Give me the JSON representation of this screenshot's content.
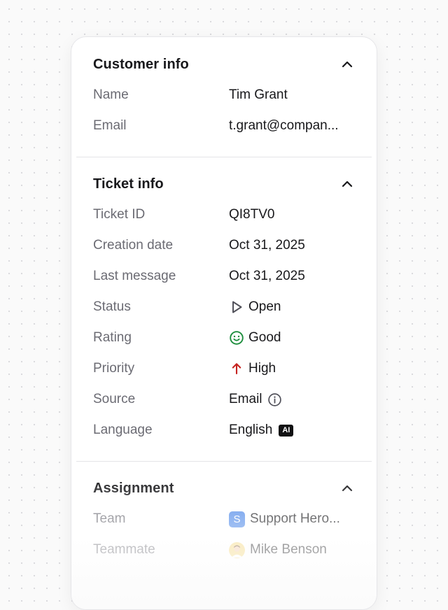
{
  "customer_info": {
    "title": "Customer info",
    "fields": {
      "name": {
        "label": "Name",
        "value": "Tim Grant"
      },
      "email": {
        "label": "Email",
        "value": "t.grant@compan..."
      }
    }
  },
  "ticket_info": {
    "title": "Ticket info",
    "fields": {
      "ticket_id": {
        "label": "Ticket ID",
        "value": "QI8TV0"
      },
      "creation_date": {
        "label": "Creation date",
        "value": "Oct 31, 2025"
      },
      "last_message": {
        "label": "Last message",
        "value": "Oct 31, 2025"
      },
      "status": {
        "label": "Status",
        "value": "Open",
        "icon": "play-outline-icon",
        "color": "#52525b"
      },
      "rating": {
        "label": "Rating",
        "value": "Good",
        "icon": "smile-icon",
        "color": "#1e8e3e"
      },
      "priority": {
        "label": "Priority",
        "value": "High",
        "icon": "arrow-up-icon",
        "color": "#c5221f"
      },
      "source": {
        "label": "Source",
        "value": "Email",
        "icon": "info-icon"
      },
      "language": {
        "label": "Language",
        "value": "English",
        "badge": "AI"
      }
    }
  },
  "assignment": {
    "title": "Assignment",
    "fields": {
      "team": {
        "label": "Team",
        "value": "Support Hero...",
        "avatar_letter": "S",
        "avatar_color": "#4a86e8"
      },
      "teammate": {
        "label": "Teammate",
        "value": "Mike Benson",
        "avatar": "user-avatar"
      }
    }
  }
}
